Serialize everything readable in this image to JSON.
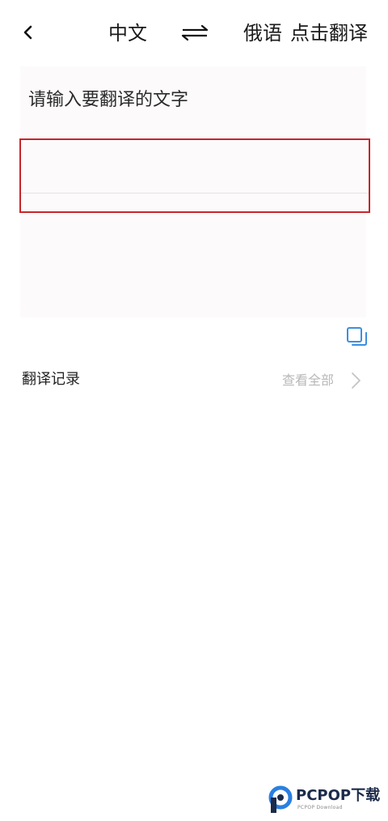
{
  "header": {
    "back_icon": "chevron-left-icon",
    "source_language": "中文",
    "swap_icon": "swap-arrows-icon",
    "target_language": "俄语",
    "translate_label": "点击翻译"
  },
  "input": {
    "placeholder": "请输入要翻译的文字"
  },
  "actions": {
    "copy_icon": "copy-icon"
  },
  "history": {
    "title": "翻译记录",
    "view_all_label": "查看全部",
    "chevron_icon": "chevron-right-icon"
  },
  "watermark": {
    "brand": "PCPOP下载",
    "sub": "PCPOP Download"
  },
  "colors": {
    "highlight_border": "#c8262b",
    "accent_blue": "#3d8fe0",
    "card_background": "#fcfafb"
  }
}
